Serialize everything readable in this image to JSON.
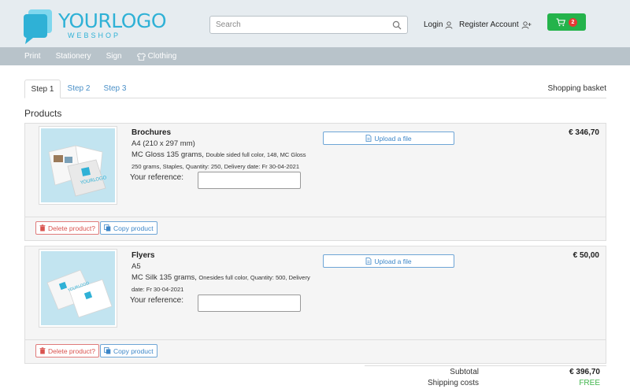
{
  "header": {
    "logo_main_a": "YOUR",
    "logo_main_b": "LOGO",
    "logo_sub": "WEBSHOP",
    "search_placeholder": "Search",
    "login_label": "Login",
    "account_label": "Register Account",
    "cart_count": "2"
  },
  "nav": {
    "items": [
      "Print",
      "Stationery",
      "Sign",
      "Clothing"
    ]
  },
  "tabs": {
    "items": [
      "Step 1",
      "Step 2",
      "Step 3"
    ],
    "active": "Step 1",
    "right_label": "Shopping basket"
  },
  "products_title": "Products",
  "products": [
    {
      "name": "Brochures",
      "format": "A4 (210 x 297 mm)",
      "desc_main": "MC Gloss 135 grams,",
      "desc_rest": "Double sided full color, 148, MC Gloss 250 grams, Staples, Quantity: 250, Delivery date: Fr 30-04-2021",
      "reference_label": "Your reference:",
      "reference_value": "",
      "upload_label": "Upload a file",
      "price": "€ 346,70",
      "delete_label": "Delete product?",
      "copy_label": "Copy product"
    },
    {
      "name": "Flyers",
      "format": "A5",
      "desc_main": "MC Silk 135 grams,",
      "desc_rest": "Onesides full color, Quantity: 500, Delivery date: Fr 30-04-2021",
      "reference_label": "Your reference:",
      "reference_value": "",
      "upload_label": "Upload a file",
      "price": "€ 50,00",
      "delete_label": "Delete product?",
      "copy_label": "Copy product"
    }
  ],
  "totals": {
    "subtotal_label": "Subtotal",
    "subtotal_value": "€ 396,70",
    "shipping_label": "Shipping costs",
    "shipping_value": "FREE"
  },
  "colors": {
    "brand": "#2fb1d6",
    "cart_green": "#24b34b",
    "badge_red": "#e53935",
    "link_blue": "#3c86c8",
    "danger": "#d9534f",
    "free_green": "#3fb54a"
  },
  "icons": {
    "search": "search-icon",
    "login": "user-icon",
    "account": "user-plus-icon",
    "cart": "cart-icon",
    "clothing": "tshirt-icon",
    "upload": "file-icon",
    "delete": "trash-icon",
    "copy": "copy-icon"
  }
}
